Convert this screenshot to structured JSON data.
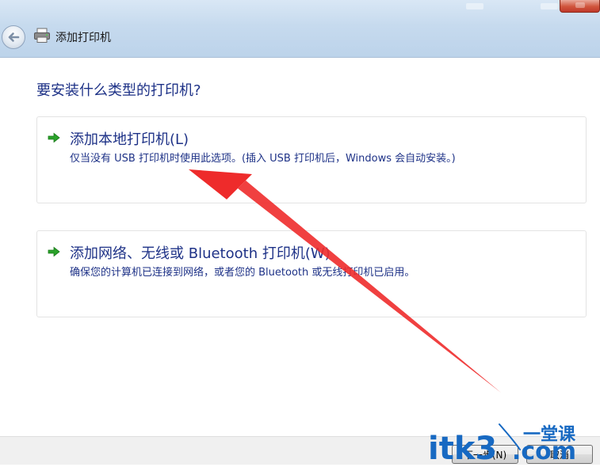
{
  "window": {
    "title": "添加打印机",
    "icons": {
      "back": "back-arrow-icon",
      "printer": "printer-icon",
      "close": "close-icon"
    }
  },
  "main": {
    "question": "要安装什么类型的打印机?",
    "options": [
      {
        "title": "添加本地打印机(L)",
        "description": "仅当没有 USB 打印机时使用此选项。(插入 USB 打印机后，Windows 会自动安装。)",
        "icon": "green-arrow-icon"
      },
      {
        "title": "添加网络、无线或 Bluetooth 打印机(W)",
        "description": "确保您的计算机已连接到网络，或者您的 Bluetooth 或无线打印机已启用。",
        "icon": "green-arrow-icon"
      }
    ]
  },
  "footer": {
    "next_label": "下一步(N)",
    "cancel_label": "取消"
  },
  "watermark": {
    "brand": "itk3",
    "domain": ".com",
    "tagline": "一堂课"
  },
  "colors": {
    "link_blue": "#1e3287",
    "annotation_red": "#ee2b2b",
    "watermark_blue": "#1769c2",
    "arrow_green": "#2aa22a"
  }
}
